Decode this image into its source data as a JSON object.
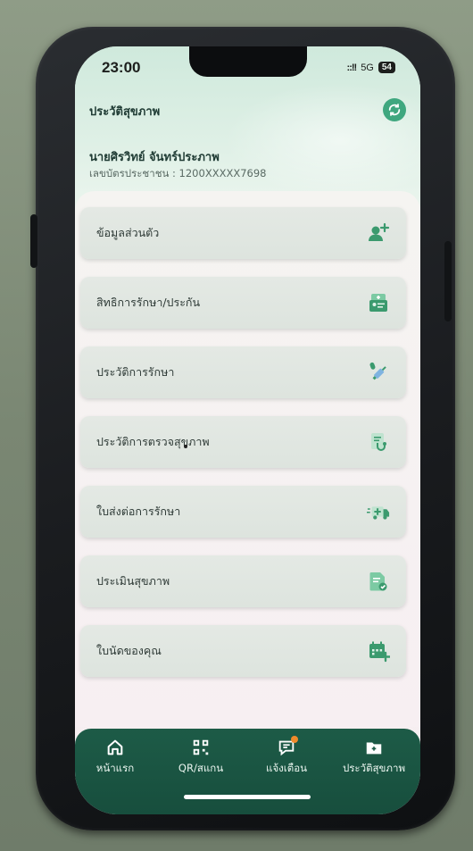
{
  "status_bar": {
    "time": "23:00",
    "signal": "::!!",
    "network": "5G",
    "battery": "54"
  },
  "header": {
    "title": "ประวัติสุขภาพ",
    "refresh_icon": "refresh-icon"
  },
  "user": {
    "name": "นายศิรวิทย์ จันทร์ประภาพ",
    "id_line": "เลขบัตรประชาชน : 1200XXXXX7698"
  },
  "menu": [
    {
      "label": "ข้อมูลส่วนตัว",
      "icon": "add-person-icon"
    },
    {
      "label": "สิทธิการรักษา/ประกัน",
      "icon": "id-card-icon"
    },
    {
      "label": "ประวัติการรักษา",
      "icon": "syringe-icon"
    },
    {
      "label": "ประวัติการตรวจสุขภาพ",
      "icon": "stethoscope-doc-icon"
    },
    {
      "label": "ใบส่งต่อการรักษา",
      "icon": "ambulance-icon"
    },
    {
      "label": "ประเมินสุขภาพ",
      "icon": "checklist-doc-icon"
    },
    {
      "label": "ใบนัดของคุณ",
      "icon": "calendar-add-icon"
    }
  ],
  "tabbar": [
    {
      "label": "หน้าแรก",
      "icon": "home-icon"
    },
    {
      "label": "QR/สแกน",
      "icon": "qr-scan-icon"
    },
    {
      "label": "แจ้งเตือน",
      "icon": "chat-bell-icon"
    },
    {
      "label": "ประวัติสุขภาพ",
      "icon": "health-folder-icon"
    }
  ],
  "colors": {
    "accent": "#3fa77f",
    "tabbar": "#1d5b47",
    "icon_green": "#3b9a6e",
    "notification": "#f08a2b"
  }
}
